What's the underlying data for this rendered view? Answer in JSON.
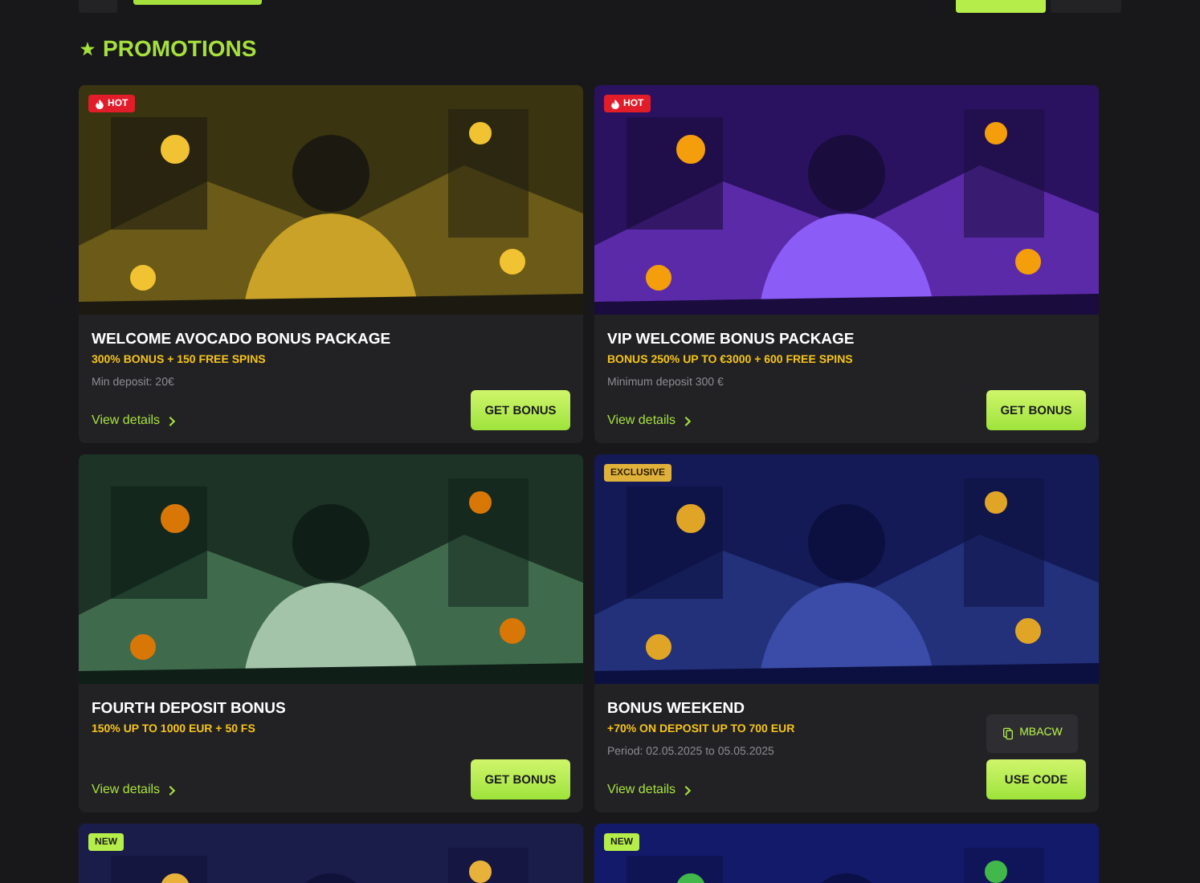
{
  "heading": {
    "title": "PROMOTIONS"
  },
  "promotions": [
    {
      "badge": {
        "kind": "hot",
        "text": "HOT"
      },
      "title": "WELCOME AVOCADO BONUS PACKAGE",
      "offer": "300% BONUS + 150 FREE SPINS",
      "details": "Min deposit: 20€",
      "link": "View details",
      "button": "GET BONUS"
    },
    {
      "title": "FOURTH DEPOSIT BONUS",
      "offer": "150% UP TO 1000 EUR + 50 FS",
      "link": "View details",
      "button": "GET BONUS"
    },
    {
      "badge": {
        "kind": "new",
        "text": "NEW"
      }
    },
    {
      "badge": {
        "kind": "hot",
        "text": "HOT"
      },
      "title": "VIP WELCOME BONUS PACKAGE",
      "offer": "BONUS 250% UP TO €3000 + 600 FREE SPINS",
      "details": "Minimum deposit 300 €",
      "link": "View details",
      "button": "GET BONUS"
    },
    {
      "badge": {
        "kind": "exclusive",
        "text": "EXCLUSIVE"
      },
      "title": "BONUS WEEKEND",
      "offer": "+70% ON DEPOSIT UP TO 700 EUR",
      "details": "Period: 02.05.2025 to 05.05.2025",
      "code": "MBACW",
      "link": "View details",
      "button": "USE CODE"
    },
    {
      "badge": {
        "kind": "new",
        "text": "NEW"
      }
    }
  ]
}
